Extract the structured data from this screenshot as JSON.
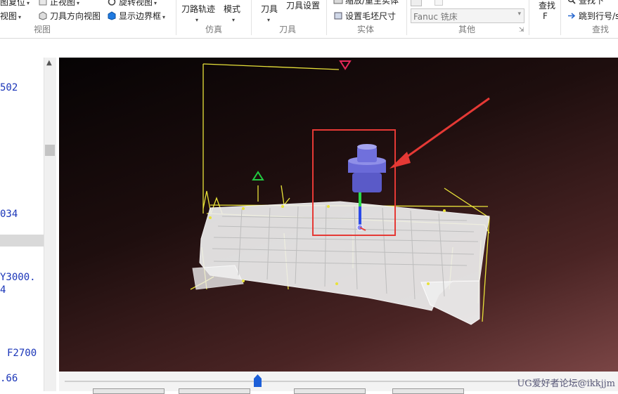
{
  "ribbon": {
    "view_group": {
      "label": "视图",
      "items": [
        "图复位",
        "视图",
        "正视图",
        "刀具方向视图",
        "旋转视图",
        "显示边界框"
      ]
    },
    "sim_group": {
      "label": "仿真",
      "items": [
        "刀路轨迹",
        "模式"
      ]
    },
    "tool_group": {
      "label": "刀具",
      "items": [
        "刀具",
        "刀具设置"
      ]
    },
    "solid_group": {
      "label": "实体",
      "items": [
        "缩放/重生实体",
        "设置毛坯尺寸"
      ]
    },
    "other_group": {
      "label": "其他",
      "machine_select": "Fanuc 铣床"
    },
    "find_group": {
      "label": "查找",
      "items": [
        "查找",
        "F",
        "查找下",
        "跳到行号/s"
      ]
    }
  },
  "code_panel": {
    "lines": [
      "502",
      "034",
      "Y3000.",
      "4",
      "F2700",
      ".66"
    ]
  },
  "viewport": {
    "highlight_color": "#e53935",
    "wire_color": "#e8e23a",
    "mesh_color": "#f2f2f2",
    "tool_color": "#6a6ad8"
  },
  "watermark": "UG爱好者论坛@ikkjjm"
}
